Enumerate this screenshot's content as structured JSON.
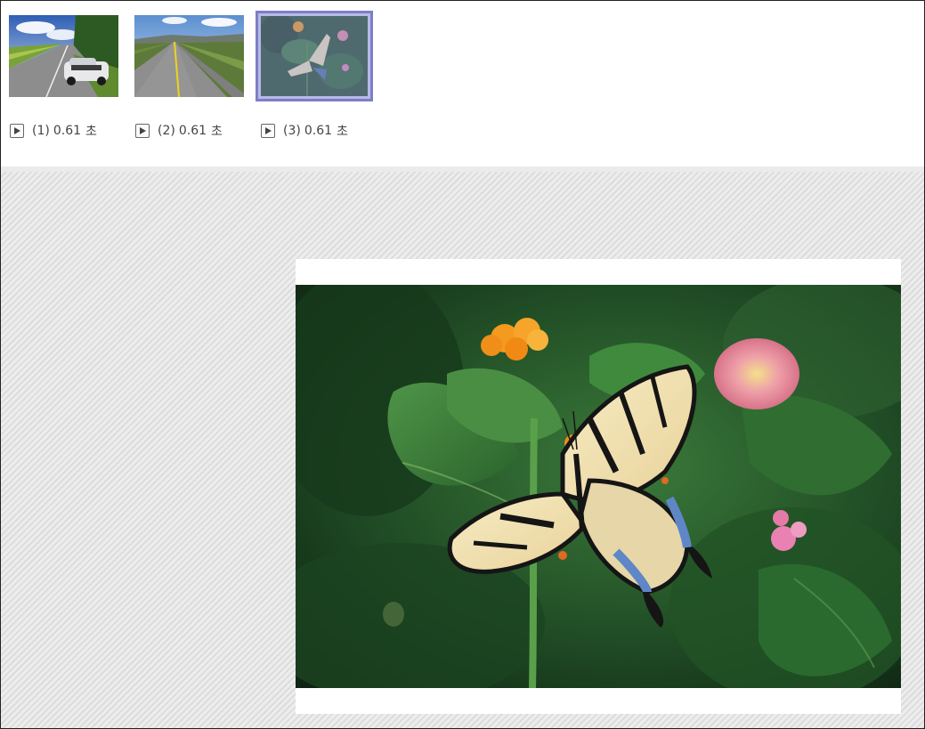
{
  "frames": [
    {
      "index_label": "(1)",
      "duration": "0.61",
      "unit": "초",
      "image": "road-with-white-sports-car",
      "selected": false
    },
    {
      "index_label": "(2)",
      "duration": "0.61",
      "unit": "초",
      "image": "straight-road-yellow-line",
      "selected": false
    },
    {
      "index_label": "(3)",
      "duration": "0.61",
      "unit": "초",
      "image": "swallowtail-butterfly-on-flower",
      "selected": true
    }
  ],
  "icons": {
    "play": "play-icon"
  },
  "colors": {
    "selection_border": "#7c7fc6",
    "preview_background": "#e7e7e7",
    "frame_border": "#222222"
  },
  "preview": {
    "image": "swallowtail-butterfly-on-flower"
  }
}
